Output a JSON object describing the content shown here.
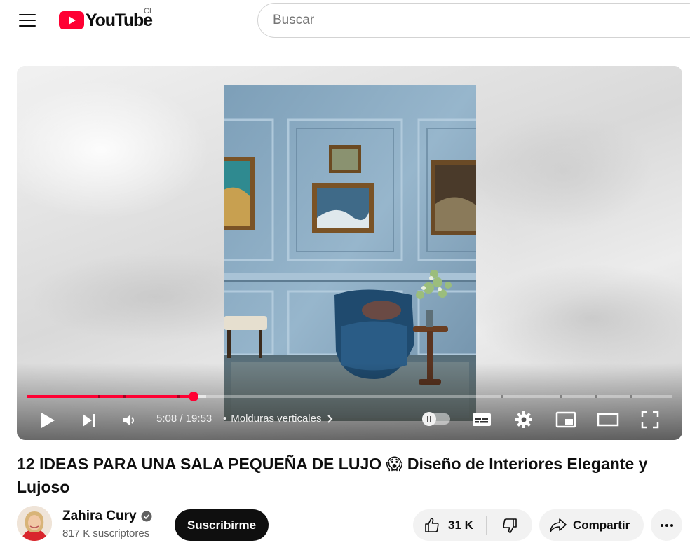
{
  "header": {
    "logo_text": "YouTube",
    "country_code": "CL",
    "search_placeholder": "Buscar"
  },
  "player": {
    "current_time": "5:08",
    "duration": "19:53",
    "time_separator": "/",
    "chapter_title": "Molduras verticales",
    "progress_fraction": 0.258,
    "buffered_fraction": 0.278,
    "accent_color": "#ff0033"
  },
  "video": {
    "title": "12 IDEAS PARA UNA SALA PEQUEÑA DE LUJO 😱 Diseño de Interiores Elegante y Lujoso"
  },
  "channel": {
    "name": "Zahira Cury",
    "verified": true,
    "subscribers": "817 K suscriptores",
    "subscribe_label": "Suscribirme"
  },
  "actions": {
    "like_count": "31 K",
    "share_label": "Compartir"
  },
  "icons": [
    "menu-icon",
    "youtube-logo-icon",
    "play-icon",
    "next-icon",
    "volume-icon",
    "chevron-right-icon",
    "autoplay-toggle",
    "subtitles-icon",
    "settings-gear-icon",
    "miniplayer-icon",
    "theater-mode-icon",
    "fullscreen-icon",
    "verified-badge-icon",
    "thumbs-up-icon",
    "thumbs-down-icon",
    "share-arrow-icon",
    "more-dots-icon"
  ]
}
